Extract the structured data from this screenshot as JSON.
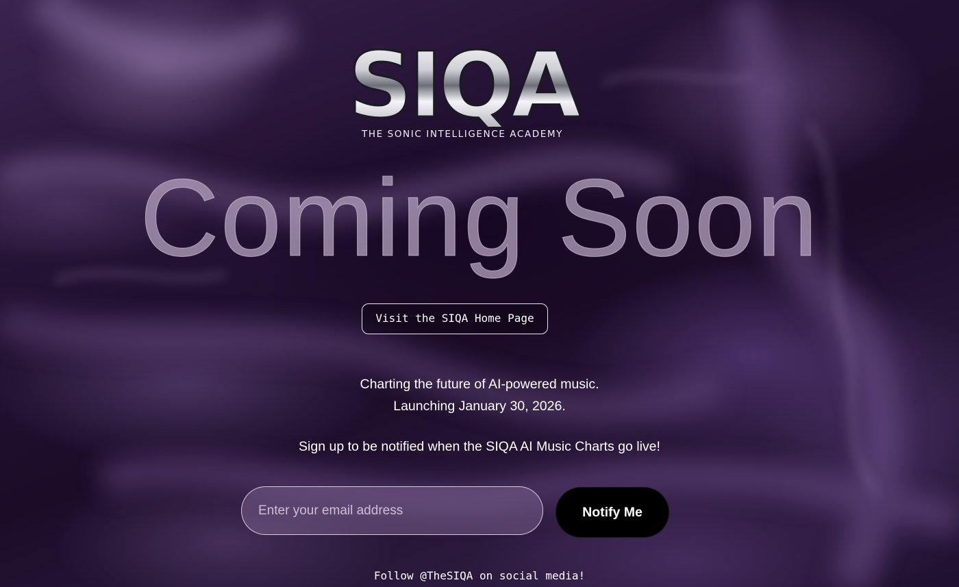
{
  "brand": {
    "logo_text": "SIQA",
    "logo_subtitle": "THE SONIC INTELLIGENCE ACADEMY"
  },
  "hero": {
    "headline": "Coming Soon"
  },
  "home_button": {
    "label": "Visit the SIQA Home Page"
  },
  "intro": {
    "line1": "Charting the future of AI-powered music.",
    "line2": "Launching January 30, 2026.",
    "signup": "Sign up to be notified when the SIQA AI Music Charts go live!"
  },
  "form": {
    "email_placeholder": "Enter your email address",
    "email_value": "",
    "submit_label": "Notify Me"
  },
  "footer": {
    "social": "Follow @TheSIQA on social media!"
  },
  "colors": {
    "background": "#241233",
    "headline": "#a896b4",
    "button_bg": "#000000",
    "text": "#ffffff"
  }
}
